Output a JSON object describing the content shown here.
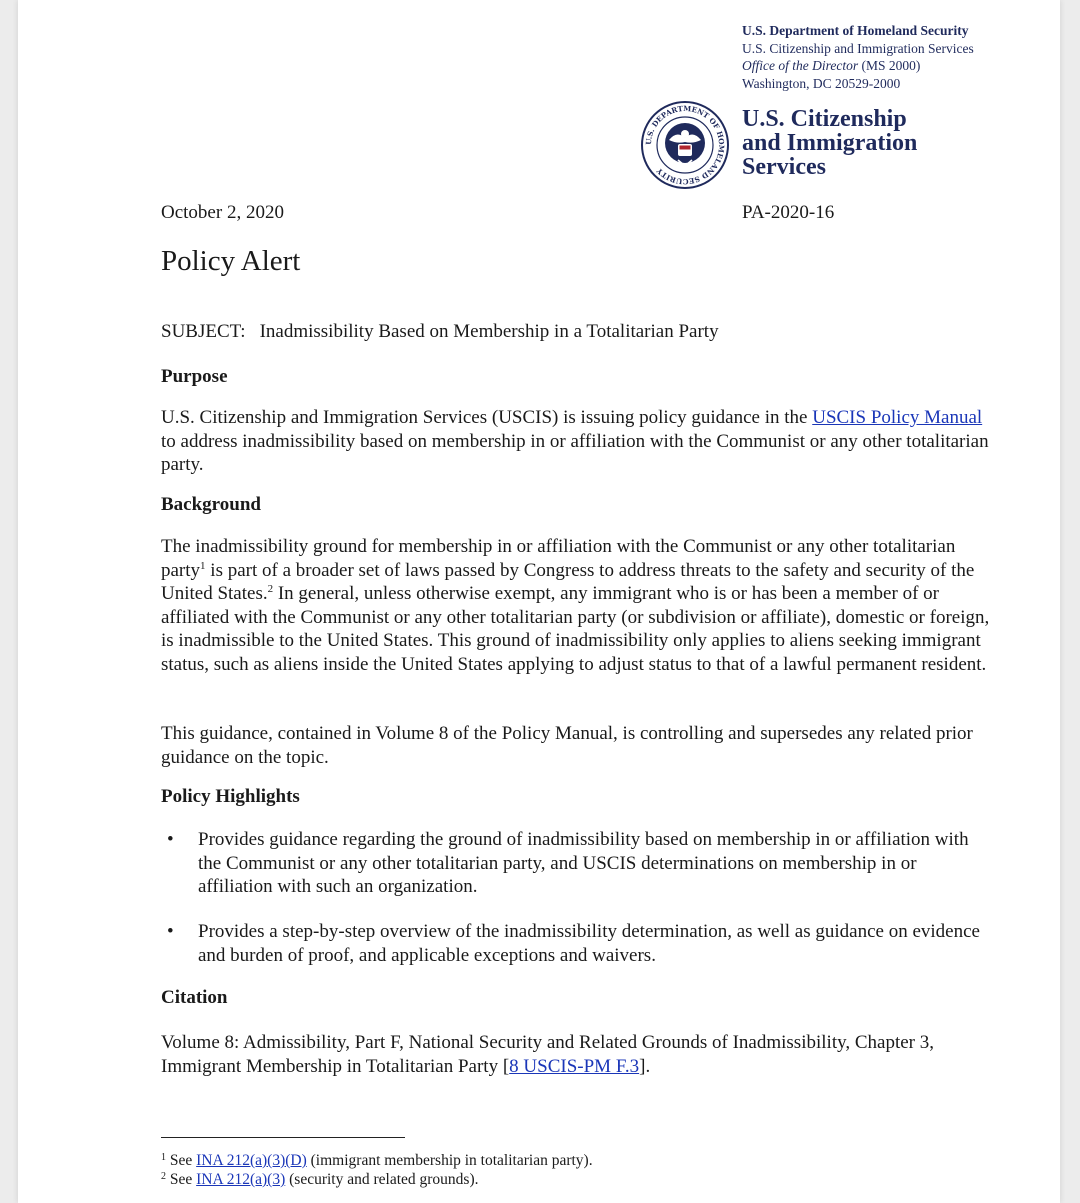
{
  "letterhead": {
    "department": "U.S. Department of Homeland Security",
    "agency": "U.S. Citizenship and Immigration Services",
    "office_italic": "Office of the Director",
    "office_code": " (MS 2000)",
    "address": "Washington, DC  20529-2000",
    "brand_line1": "U.S. Citizenship",
    "brand_line2": "and Immigration",
    "brand_line3": "Services",
    "seal_icon": "dhs-seal-icon",
    "seal_text": "U.S. DEPARTMENT OF HOMELAND SECURITY"
  },
  "date": "October 2, 2020",
  "alert_id": "PA-2020-16",
  "title": "Policy Alert",
  "subject": {
    "label": "SUBJECT:",
    "text": "Inadmissibility Based on Membership in a Totalitarian Party"
  },
  "purpose": {
    "heading": "Purpose",
    "text_before": "U.S. Citizenship and Immigration Services (USCIS) is issuing policy guidance in the ",
    "link": "USCIS Policy Manual",
    "text_after": " to address inadmissibility based on membership in or affiliation with the Communist or any other totalitarian party."
  },
  "background": {
    "heading": "Background",
    "p1_a": "The inadmissibility ground for membership in or affiliation with the Communist or any other totalitarian party",
    "fn1": "1",
    "p1_b": " is part of a broader set of laws passed by Congress to address threats to the safety and security of the United States.",
    "fn2": "2",
    "p1_c": " In general, unless otherwise exempt, any immigrant who is or has been a member of or affiliated with the Communist or any other totalitarian party (or subdivision or affiliate), domestic or foreign, is inadmissible to the United States. This ground of inadmissibility only applies to aliens seeking immigrant status, such as aliens inside the United States applying to adjust status to that of a lawful permanent resident.",
    "p2": "This guidance, contained in Volume 8 of the Policy Manual, is controlling and supersedes any related prior guidance on the topic."
  },
  "highlights": {
    "heading": "Policy Highlights",
    "bullet_glyph": "•",
    "items": [
      "Provides guidance regarding the ground of inadmissibility based on membership in or affiliation with the Communist or any other totalitarian party, and USCIS determinations on membership in or affiliation with such an organization.",
      "Provides a step-by-step overview of the inadmissibility determination, as well as guidance on evidence and burden of proof, and applicable exceptions and waivers."
    ]
  },
  "citation": {
    "heading": "Citation",
    "text_before": "Volume 8: Admissibility, Part F, National Security and Related Grounds of Inadmissibility, Chapter 3, Immigrant Membership in Totalitarian Party [",
    "link": "8 USCIS-PM F.3",
    "text_after": "]."
  },
  "footnotes": [
    {
      "num": "1",
      "prefix": " See ",
      "link": "INA 212(a)(3)(D)",
      "suffix": " (immigrant membership in totalitarian party)."
    },
    {
      "num": "2",
      "prefix": " See ",
      "link": "INA 212(a)(3)",
      "suffix": " (security and related grounds)."
    }
  ],
  "colors": {
    "link": "#1a36b8",
    "letterhead": "#1f2a5c"
  }
}
